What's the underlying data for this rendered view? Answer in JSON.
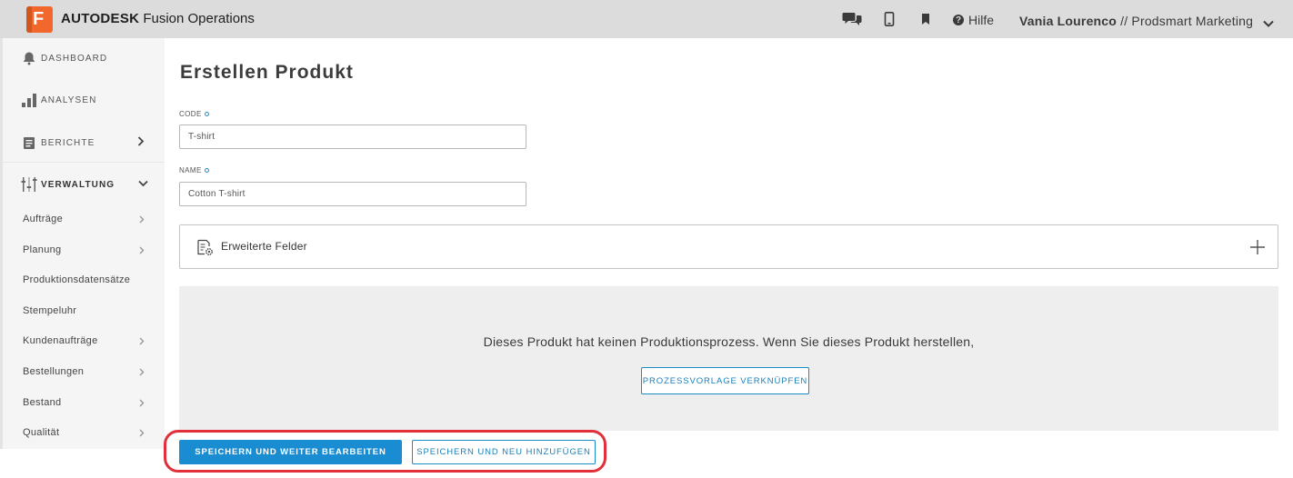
{
  "app": {
    "brand_bold": "AUTODESK",
    "brand_rest": "Fusion Operations",
    "logo_letter": "F"
  },
  "topbar": {
    "icons": [
      "chat-icon",
      "mobile-icon",
      "bookmark-icon"
    ],
    "help_label": "Hilfe",
    "user_name": "Vania Lourenco",
    "user_separator": " // ",
    "workspace": "Prodsmart Marketing"
  },
  "sidebar": {
    "main_items": [
      {
        "label": "DASHBOARD",
        "icon": "bell-icon"
      },
      {
        "label": "ANALYSEN",
        "icon": "bar-chart-icon"
      },
      {
        "label": "BERICHTE",
        "icon": "report-icon"
      },
      {
        "label": "VERWALTUNG",
        "icon": "sliders-icon"
      }
    ],
    "sub_items": [
      {
        "label": "Aufträge"
      },
      {
        "label": "Planung"
      },
      {
        "label": "Produktionsdatensätze"
      },
      {
        "label": "Stempeluhr"
      },
      {
        "label": "Kundenaufträge"
      },
      {
        "label": "Bestellungen"
      },
      {
        "label": "Bestand"
      },
      {
        "label": "Qualität"
      }
    ]
  },
  "page": {
    "title": "Erstellen Produkt"
  },
  "form": {
    "code_label": "CODE",
    "code_value": "T-shirt",
    "name_label": "NAME",
    "name_value": "Cotton T-shirt",
    "advanced_label": "Erweiterte Felder"
  },
  "process": {
    "message": "Dieses Produkt hat keinen Produktionsprozess. Wenn Sie dieses Produkt herstellen,",
    "link_button": "PROZESSVORLAGE VERKNÜPFEN"
  },
  "actions": {
    "save_continue": "SPEICHERN UND WEITER BEARBEITEN",
    "save_new": "SPEICHERN UND NEU HINZUFÜGEN"
  },
  "colors": {
    "accent": "#1a8cd1",
    "highlight": "#e2303a",
    "logo": "#f1672c",
    "topbar": "#dcdcdc"
  }
}
